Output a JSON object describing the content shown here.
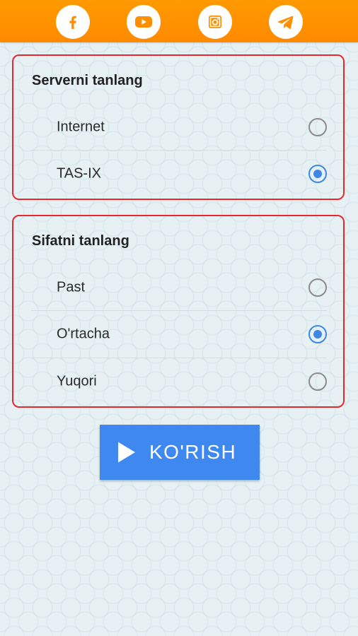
{
  "social": [
    {
      "icon": "facebook-icon"
    },
    {
      "icon": "youtube-icon"
    },
    {
      "icon": "instagram-icon"
    },
    {
      "icon": "telegram-icon"
    }
  ],
  "colors": {
    "topbar": "#ff9000",
    "card_border": "#e8282f",
    "radio_checked": "#3d87e6",
    "button": "#3f88f0"
  },
  "server": {
    "title": "Serverni tanlang",
    "options": [
      {
        "label": "Internet",
        "selected": false
      },
      {
        "label": "TAS-IX",
        "selected": true
      }
    ]
  },
  "quality": {
    "title": "Sifatni tanlang",
    "options": [
      {
        "label": "Past",
        "selected": false
      },
      {
        "label": "O'rtacha",
        "selected": true
      },
      {
        "label": "Yuqori",
        "selected": false
      }
    ]
  },
  "watch_button": {
    "label": "KO'RISH",
    "icon": "play-icon"
  }
}
